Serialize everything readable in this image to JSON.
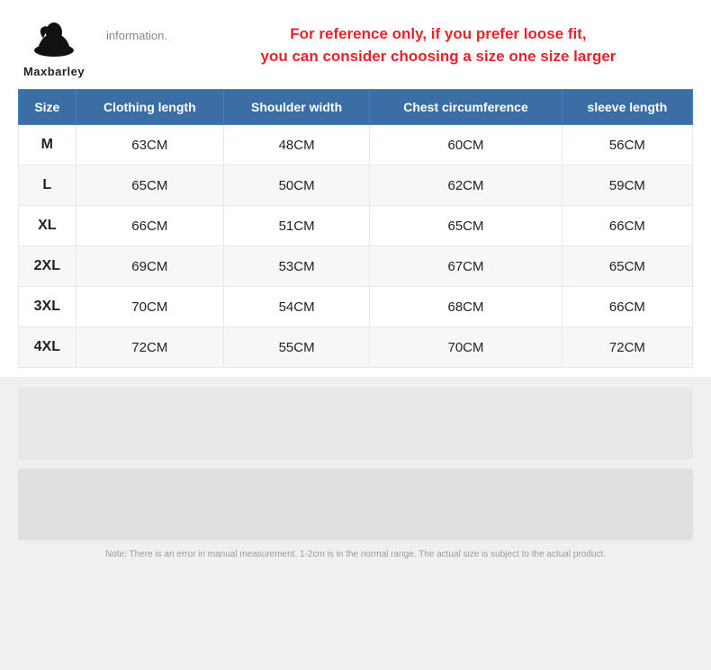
{
  "brand": {
    "name": "Maxbarley",
    "info_text": "information."
  },
  "notice": {
    "line1": "For reference only, if you prefer loose fit,",
    "line2": "you can consider choosing a size one size larger"
  },
  "table": {
    "headers": [
      "Size",
      "Clothing length",
      "Shoulder width",
      "Chest circumference",
      "sleeve length"
    ],
    "rows": [
      {
        "size": "M",
        "clothing_length": "63CM",
        "shoulder_width": "48CM",
        "chest_circumference": "60CM",
        "sleeve_length": "56CM"
      },
      {
        "size": "L",
        "clothing_length": "65CM",
        "shoulder_width": "50CM",
        "chest_circumference": "62CM",
        "sleeve_length": "59CM"
      },
      {
        "size": "XL",
        "clothing_length": "66CM",
        "shoulder_width": "51CM",
        "chest_circumference": "65CM",
        "sleeve_length": "66CM"
      },
      {
        "size": "2XL",
        "clothing_length": "69CM",
        "shoulder_width": "53CM",
        "chest_circumference": "67CM",
        "sleeve_length": "65CM"
      },
      {
        "size": "3XL",
        "clothing_length": "70CM",
        "shoulder_width": "54CM",
        "chest_circumference": "68CM",
        "sleeve_length": "66CM"
      },
      {
        "size": "4XL",
        "clothing_length": "72CM",
        "shoulder_width": "55CM",
        "chest_circumference": "70CM",
        "sleeve_length": "72CM"
      }
    ]
  },
  "note": "Note: There is an error in manual measurement. 1-2cm is in the normal range. The actual size is subject to the actual product."
}
